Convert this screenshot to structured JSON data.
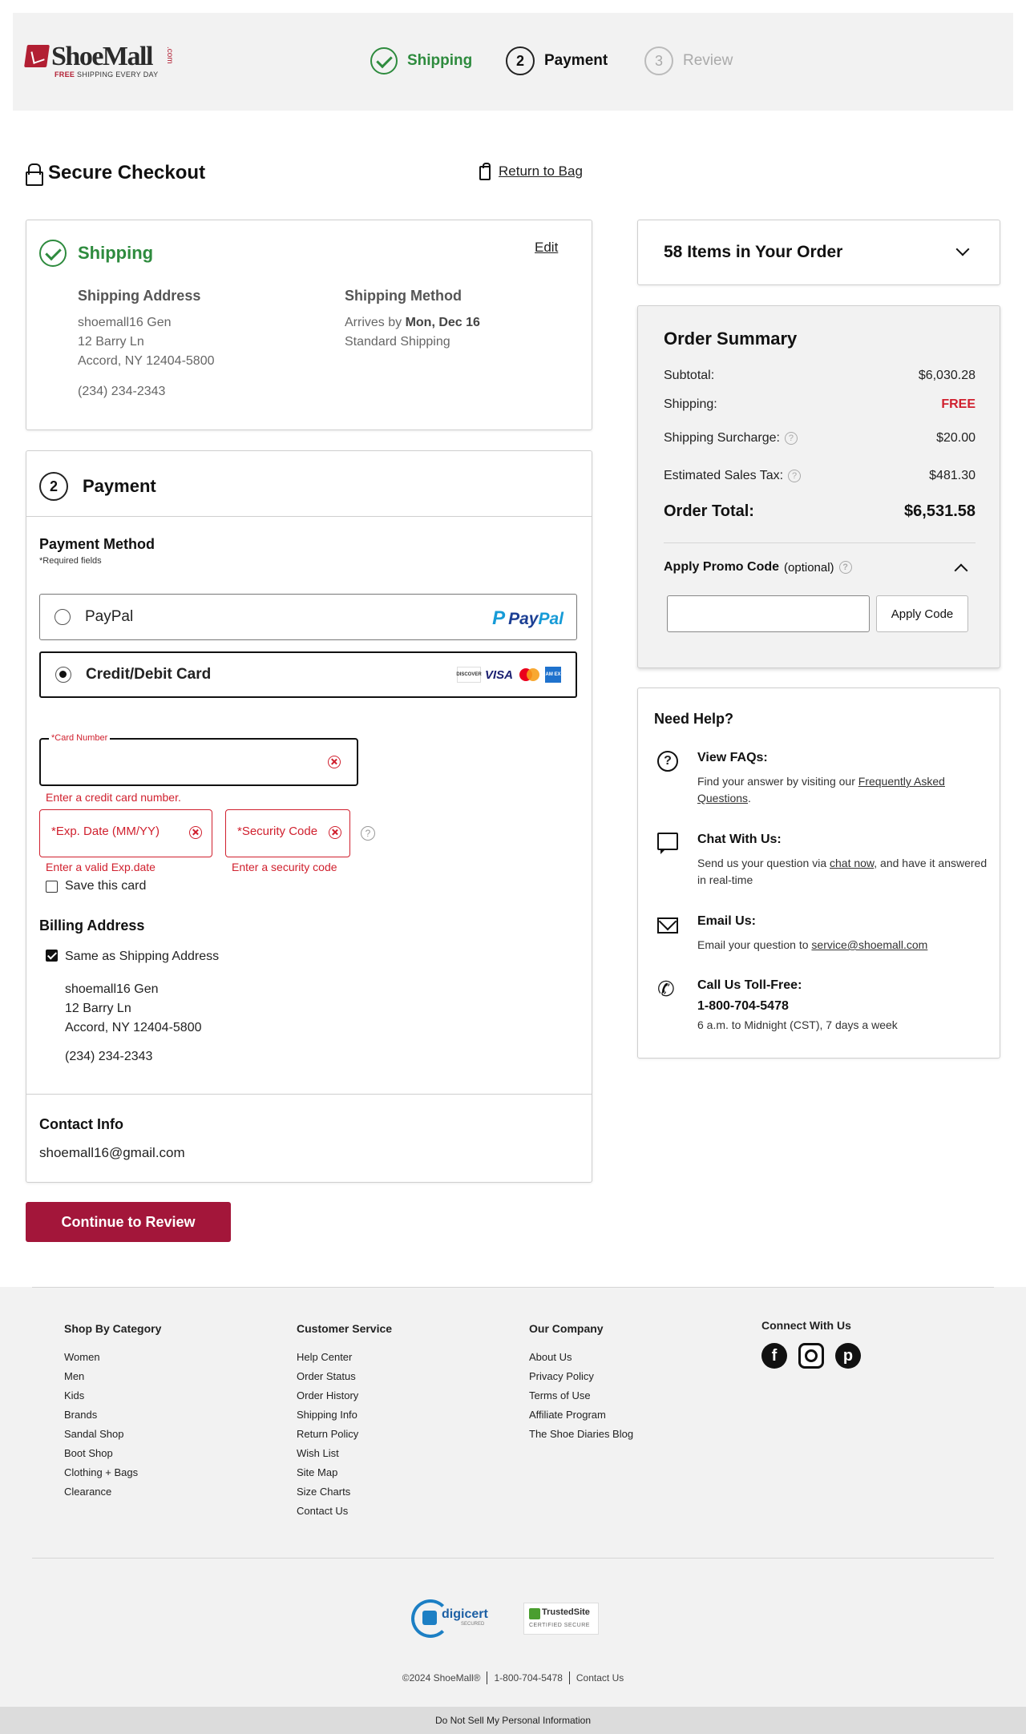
{
  "brand": {
    "name": "ShoeMall",
    "com": ".com",
    "tagline_free": "FREE",
    "tagline_rest": "SHIPPING EVERY DAY"
  },
  "steps": [
    {
      "num": "",
      "label": "Shipping",
      "state": "done"
    },
    {
      "num": "2",
      "label": "Payment",
      "state": "active"
    },
    {
      "num": "3",
      "label": "Review",
      "state": "todo"
    }
  ],
  "page": {
    "title": "Secure Checkout",
    "return_link": "Return to Bag"
  },
  "shipping": {
    "title": "Shipping",
    "edit": "Edit",
    "address_heading": "Shipping Address",
    "address": [
      "shoemall16 Gen",
      "12 Barry Ln",
      "Accord, NY 12404-5800"
    ],
    "phone": "(234) 234-2343",
    "method_heading": "Shipping Method",
    "arrives_prefix": "Arrives by",
    "arrives_date": "Mon, Dec 16",
    "method": "Standard Shipping"
  },
  "payment": {
    "step_num": "2",
    "title": "Payment",
    "method_heading": "Payment Method",
    "required_note": "*Required fields",
    "options": [
      {
        "label": "PayPal",
        "selected": false
      },
      {
        "label": "Credit/Debit Card",
        "selected": true
      }
    ],
    "paypal_logo_pay": "Pay",
    "paypal_logo_pal": "Pal",
    "card_logos": {
      "discover": "DISCOVER",
      "visa": "VISA",
      "amex": "AM EX"
    },
    "card_number": {
      "label": "*Card Number",
      "value": "",
      "error": "Enter a credit card number."
    },
    "exp_date": {
      "placeholder": "*Exp. Date (MM/YY)",
      "error": "Enter a valid Exp.date"
    },
    "security_code": {
      "placeholder": "*Security Code",
      "error": "Enter a security code"
    },
    "save_card": {
      "label": "Save this card",
      "checked": false
    }
  },
  "billing": {
    "heading": "Billing Address",
    "same_as_shipping": {
      "label": "Same as Shipping Address",
      "checked": true
    },
    "address": [
      "shoemall16 Gen",
      "12 Barry Ln",
      "Accord, NY 12404-5800"
    ],
    "phone": "(234) 234-2343"
  },
  "contact": {
    "heading": "Contact Info",
    "email": "shoemall16@gmail.com"
  },
  "cta": "Continue to Review",
  "order": {
    "items_title": "58 Items in Your Order",
    "summary_title": "Order Summary",
    "subtotal_label": "Subtotal:",
    "subtotal": "$6,030.28",
    "shipping_label": "Shipping:",
    "shipping": "FREE",
    "surcharge_label": "Shipping Surcharge:",
    "surcharge": "$20.00",
    "tax_label": "Estimated Sales Tax:",
    "tax": "$481.30",
    "total_label": "Order Total:",
    "total": "$6,531.58",
    "promo_label": "Apply Promo Code",
    "promo_optional": "(optional)",
    "promo_value": "",
    "promo_button": "Apply Code"
  },
  "help": {
    "title": "Need Help?",
    "faq_heading": "View FAQs:",
    "faq_text": "Find your answer by visiting our",
    "faq_link": "Frequently Asked Questions",
    "chat_heading": "Chat With Us:",
    "chat_text_a": "Send us your question via",
    "chat_link": "chat now",
    "chat_text_b": ", and have it answered in real-time",
    "email_heading": "Email Us:",
    "email_text": "Email your question to",
    "email_link": "service@shoemall.com",
    "phone_heading": "Call Us Toll-Free:",
    "phone_number": "1-800-704-5478",
    "phone_hours": "6 a.m. to Midnight (CST), 7 days a week"
  },
  "footer": {
    "col1": {
      "heading": "Shop By Category",
      "links": [
        "Women",
        "Men",
        "Kids",
        "Brands",
        "Sandal Shop",
        "Boot Shop",
        "Clothing + Bags",
        "Clearance"
      ]
    },
    "col2": {
      "heading": "Customer Service",
      "links": [
        "Help Center",
        "Order Status",
        "Order History",
        "Shipping Info",
        "Return Policy",
        "Wish List",
        "Site Map",
        "Size Charts",
        "Contact Us"
      ]
    },
    "col3": {
      "heading": "Our Company",
      "links": [
        "About Us",
        "Privacy Policy",
        "Terms of Use",
        "Affiliate Program",
        "The Shoe Diaries Blog"
      ]
    },
    "connect_heading": "Connect With Us",
    "social_icons": [
      "facebook-icon",
      "instagram-icon",
      "pinterest-icon"
    ],
    "digicert_text": "digicert",
    "digicert_sub": "SECURED",
    "trusted_text": "TrustedSite",
    "trusted_sub": "CERTIFIED SECURE",
    "copyright": "©2024 ShoeMall®",
    "phone": "1-800-704-5478",
    "contact": "Contact Us",
    "dns": "Do Not Sell My Personal Information"
  },
  "colors": {
    "brand": "#b21f33",
    "success": "#2e8b3e",
    "error": "#d0202e",
    "cta": "#a3163a"
  }
}
